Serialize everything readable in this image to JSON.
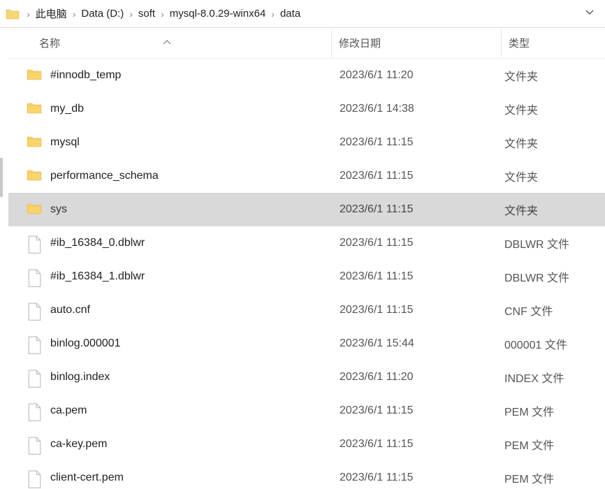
{
  "breadcrumb": {
    "items": [
      "此电脑",
      "Data (D:)",
      "soft",
      "mysql-8.0.29-winx64",
      "data"
    ]
  },
  "columns": {
    "name": "名称",
    "date": "修改日期",
    "type": "类型"
  },
  "icons": {
    "folder": "folder",
    "file": "file"
  },
  "files": [
    {
      "name": "#innodb_temp",
      "date": "2023/6/1 11:20",
      "type": "文件夹",
      "icon": "folder",
      "selected": false
    },
    {
      "name": "my_db",
      "date": "2023/6/1 14:38",
      "type": "文件夹",
      "icon": "folder",
      "selected": false
    },
    {
      "name": "mysql",
      "date": "2023/6/1 11:15",
      "type": "文件夹",
      "icon": "folder",
      "selected": false
    },
    {
      "name": "performance_schema",
      "date": "2023/6/1 11:15",
      "type": "文件夹",
      "icon": "folder",
      "selected": false
    },
    {
      "name": "sys",
      "date": "2023/6/1 11:15",
      "type": "文件夹",
      "icon": "folder",
      "selected": true
    },
    {
      "name": "#ib_16384_0.dblwr",
      "date": "2023/6/1 11:15",
      "type": "DBLWR 文件",
      "icon": "file",
      "selected": false
    },
    {
      "name": "#ib_16384_1.dblwr",
      "date": "2023/6/1 11:15",
      "type": "DBLWR 文件",
      "icon": "file",
      "selected": false
    },
    {
      "name": "auto.cnf",
      "date": "2023/6/1 11:15",
      "type": "CNF 文件",
      "icon": "file",
      "selected": false
    },
    {
      "name": "binlog.000001",
      "date": "2023/6/1 15:44",
      "type": "000001 文件",
      "icon": "file",
      "selected": false
    },
    {
      "name": "binlog.index",
      "date": "2023/6/1 11:20",
      "type": "INDEX 文件",
      "icon": "file",
      "selected": false
    },
    {
      "name": "ca.pem",
      "date": "2023/6/1 11:15",
      "type": "PEM 文件",
      "icon": "file",
      "selected": false
    },
    {
      "name": "ca-key.pem",
      "date": "2023/6/1 11:15",
      "type": "PEM 文件",
      "icon": "file",
      "selected": false
    },
    {
      "name": "client-cert.pem",
      "date": "2023/6/1 11:15",
      "type": "PEM 文件",
      "icon": "file",
      "selected": false
    }
  ]
}
